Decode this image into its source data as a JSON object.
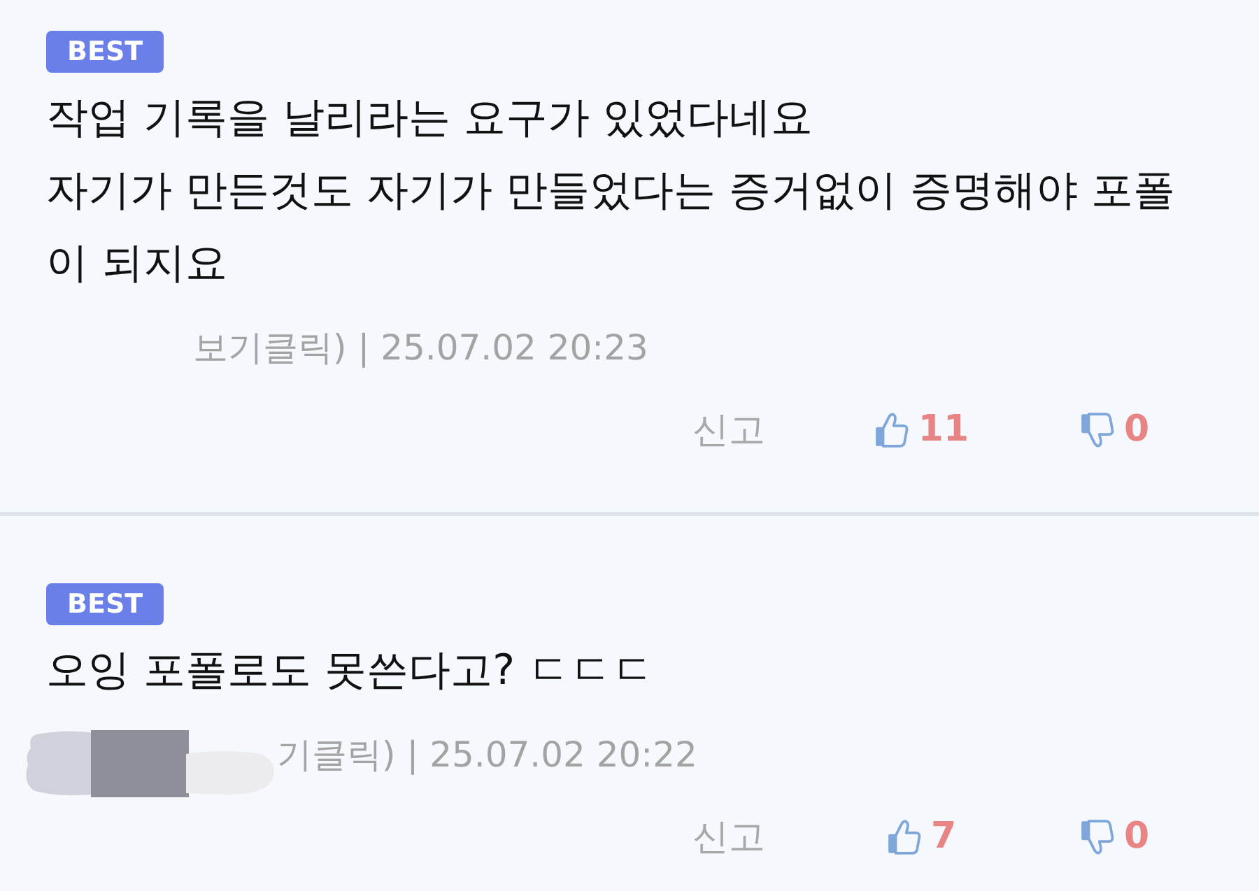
{
  "comments": [
    {
      "badge": "BEST",
      "lines": [
        "작업 기록을 날리라는 요구가 있었다네요",
        "자기가 만든것도 자기가 만들었다는 증거없이 증명해야 포폴",
        "이 되지요"
      ],
      "redaction": {
        "kind": "faint"
      },
      "meta": "보기클릭) | 25.07.02 20:23",
      "report": "신고",
      "likes": "11",
      "dislikes": "0"
    },
    {
      "badge": "BEST",
      "lines": [
        "오잉 포폴로도 못쓴다고? ㄷㄷㄷ"
      ],
      "redaction": {
        "kind": "smudge"
      },
      "meta": "기클릭) | 25.07.02 20:22",
      "report": "신고",
      "likes": "7",
      "dislikes": "0"
    }
  ]
}
